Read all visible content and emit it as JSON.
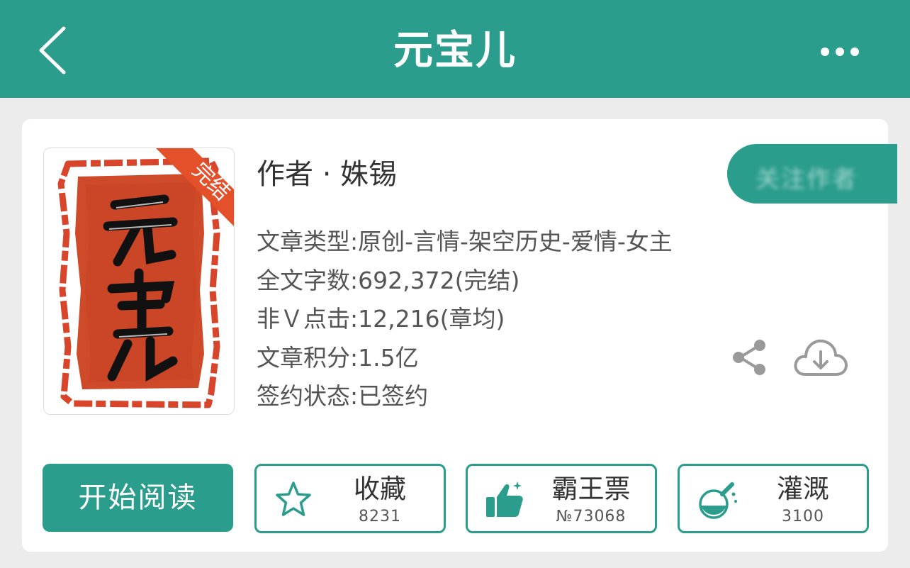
{
  "header": {
    "title": "元宝儿",
    "back_icon": "chevron-left-icon",
    "more_icon": "more-horizontal-icon",
    "background": "#2a9d8c"
  },
  "cover": {
    "badge": "完结",
    "title_art": "元宝儿",
    "badge_color": "#e4502a"
  },
  "book": {
    "author": "作者 · 姝锡",
    "info": [
      "文章类型:原创-言情-架空历史-爱情-女主",
      "全文字数:692,372(完结)",
      "非Ｖ点击:12,216(章均)",
      "文章积分:1.5亿",
      "签约状态:已签约"
    ]
  },
  "follow_button": {
    "label": "关注作者"
  },
  "icons": {
    "share": "share-icon",
    "download": "cloud-download-icon"
  },
  "actions": {
    "read": {
      "label": "开始阅读"
    },
    "collect": {
      "label": "收藏",
      "count": "8231",
      "icon": "star-icon"
    },
    "vote": {
      "label": "霸王票",
      "count": "№73068",
      "icon": "thumbs-up-icon"
    },
    "nourish": {
      "label": "灌溉",
      "count": "3100",
      "icon": "flask-icon"
    }
  },
  "accent": "#2a9d8c"
}
